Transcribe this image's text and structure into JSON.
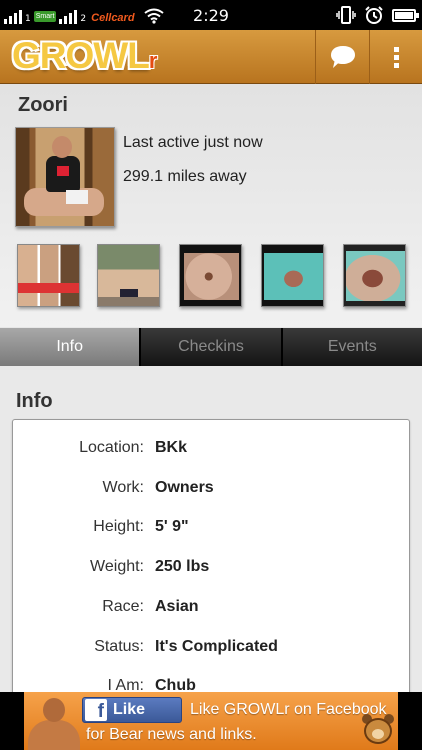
{
  "status_bar": {
    "sim1_number": "1",
    "sim1_carrier": "Smart",
    "sim2_number": "2",
    "sim2_carrier": "Cellcard",
    "time": "2:29",
    "battery_level": 0.9
  },
  "app_bar": {
    "logo_main": "GROWL",
    "logo_suffix": "r",
    "chat_icon": "chat-bubble-icon",
    "menu_icon": "overflow-menu-icon"
  },
  "profile": {
    "name": "Zoori",
    "last_active": "Last active just now",
    "distance": "299.1 miles away",
    "photo_count": 5
  },
  "tabs": [
    {
      "label": "Info",
      "active": true
    },
    {
      "label": "Checkins",
      "active": false
    },
    {
      "label": "Events",
      "active": false
    }
  ],
  "info": {
    "heading": "Info",
    "rows": [
      {
        "label": "Location:",
        "value": "BKk"
      },
      {
        "label": "Work:",
        "value": "Owners"
      },
      {
        "label": "Height:",
        "value": "5' 9\""
      },
      {
        "label": "Weight:",
        "value": "250 lbs"
      },
      {
        "label": "Race:",
        "value": "Asian"
      },
      {
        "label": "Status:",
        "value": "It's Complicated"
      },
      {
        "label": "I Am:",
        "value": "Chub"
      }
    ]
  },
  "ad": {
    "like_button": "Like",
    "line1": "Like GROWLr on Facebook",
    "line2": "for Bear news and links."
  },
  "colors": {
    "appbar": "#c98530",
    "accent_orange": "#e07a1a",
    "facebook_blue": "#3b5998"
  }
}
